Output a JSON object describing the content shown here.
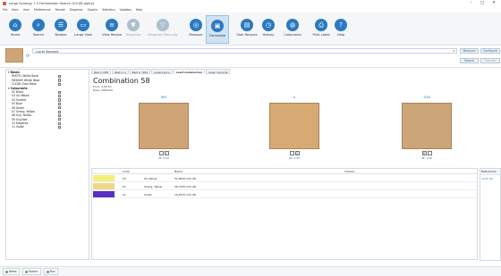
{
  "window": {
    "title": "Largo Synergy 7.5 Formulation Search (V.0.08 alpha)",
    "buttons": [
      "–",
      "□",
      "✕"
    ]
  },
  "menu": [
    "File",
    "Item",
    "User",
    "Preferences",
    "Render",
    "Dispense",
    "Graphs",
    "Statistics",
    "Updates",
    "Help"
  ],
  "ribbon": [
    {
      "label": "Home",
      "color": "#2b7ac0",
      "glyph": "⌂",
      "state": "normal"
    },
    {
      "label": "Search",
      "color": "#2b7ac0",
      "glyph": "⌕",
      "state": "normal"
    },
    {
      "label": "Browse",
      "color": "#2b7ac0",
      "glyph": "☰",
      "state": "normal"
    },
    {
      "label": "Large View",
      "color": "#2b7ac0",
      "glyph": "▭",
      "state": "normal"
    },
    {
      "label": "View Recipe",
      "color": "#2b7ac0",
      "glyph": "≡",
      "state": "normal"
    },
    {
      "label": "Dispense",
      "color": "#aebfcc",
      "glyph": "▼",
      "state": "disabled"
    },
    {
      "label": "Dispense Manually",
      "color": "#aebfcc",
      "glyph": "▽",
      "state": "disabled"
    },
    {
      "label": "Measure",
      "color": "#2b7ac0",
      "glyph": "◎",
      "state": "normal"
    },
    {
      "label": "Formulate",
      "color": "#2b7ac0",
      "glyph": "▣",
      "state": "active"
    },
    {
      "label": "User Recipes",
      "color": "#2b7ac0",
      "glyph": "▤",
      "state": "normal"
    },
    {
      "label": "History",
      "color": "#2b7ac0",
      "glyph": "◷",
      "state": "normal"
    },
    {
      "label": "Colourants",
      "color": "#2b7ac0",
      "glyph": "◍",
      "state": "normal"
    },
    {
      "label": "Print Label",
      "color": "#2b7ac0",
      "glyph": "⎙",
      "state": "normal"
    },
    {
      "label": "Help",
      "color": "#2b7ac0",
      "glyph": "?",
      "state": "normal"
    }
  ],
  "toprow": {
    "standard_value": "Lacret Standard",
    "measure_label": "Measure",
    "configure_label": "Configure",
    "search_label": "Search",
    "transfer_label": "Transfer",
    "swatch_color": "#cfa477"
  },
  "tree": [
    {
      "label": "Bases",
      "group": true,
      "indent": 0
    },
    {
      "label": "PASTEL   White Base",
      "group": false,
      "indent": 1
    },
    {
      "label": "MEDIUM  White Base",
      "group": false,
      "indent": 1
    },
    {
      "label": "CLEAR   Clear Base",
      "group": false,
      "indent": 1
    },
    {
      "label": "Colourants",
      "group": true,
      "indent": 0
    },
    {
      "label": "02      Black",
      "group": false,
      "indent": 1
    },
    {
      "label": "03      Ox.Yellow",
      "group": false,
      "indent": 1
    },
    {
      "label": "04      Oxided",
      "group": false,
      "indent": 1
    },
    {
      "label": "05      Blue",
      "group": false,
      "indent": 1
    },
    {
      "label": "06      Green",
      "group": false,
      "indent": 1
    },
    {
      "label": "07      Orang. Yellow",
      "group": false,
      "indent": 1
    },
    {
      "label": "08      Org. Yellow",
      "group": false,
      "indent": 1
    },
    {
      "label": "09      Org.Red",
      "group": false,
      "indent": 1
    },
    {
      "label": "10      Magenta",
      "group": false,
      "indent": 1
    },
    {
      "label": "11      Violet",
      "group": false,
      "indent": 1
    }
  ],
  "tabs": [
    {
      "label": "Best in D65",
      "active": false
    },
    {
      "label": "Best in A",
      "active": false
    },
    {
      "label": "Best in TL84",
      "active": false
    },
    {
      "label": "Lowest price",
      "active": false
    },
    {
      "label": "Least metamerism",
      "active": true
    },
    {
      "label": "Least colorants",
      "active": false
    }
  ],
  "combination": {
    "title": "Combination 58",
    "price": "Price: 9,86 €/l",
    "base": "Base: MEDIUM"
  },
  "lights": [
    {
      "name": "D65",
      "color": "#cfa477",
      "de": "dE: 0,00",
      "marks": [
        "",
        "✓"
      ]
    },
    {
      "name": "A",
      "color": "#d8aa73",
      "de": "dE: 0,50",
      "marks": [
        "",
        "|"
      ]
    },
    {
      "name": "TL84",
      "color": "#cca578",
      "de": "dE: 1,50",
      "marks": [
        "✕",
        ""
      ]
    }
  ],
  "grid": {
    "headers": {
      "code": "Code",
      "name": "Name",
      "volume": "Volume"
    },
    "rows": [
      {
        "color": "#f4ef7a",
        "code": "03",
        "name": "Ox.Yellow",
        "volume": "52,8970 ml/l (8)"
      },
      {
        "color": "#f2d58a",
        "code": "07",
        "name": "Orang. Yellow",
        "volume": "30,7970 ml/l (8)"
      },
      {
        "color": "#5b2fc0",
        "code": "11",
        "name": "Violet",
        "volume": "10,2570 ml/l (8)"
      }
    ]
  },
  "references": {
    "header": "References",
    "value": "1101-69"
  },
  "status_tabs": [
    "News",
    "Search",
    "Run"
  ]
}
